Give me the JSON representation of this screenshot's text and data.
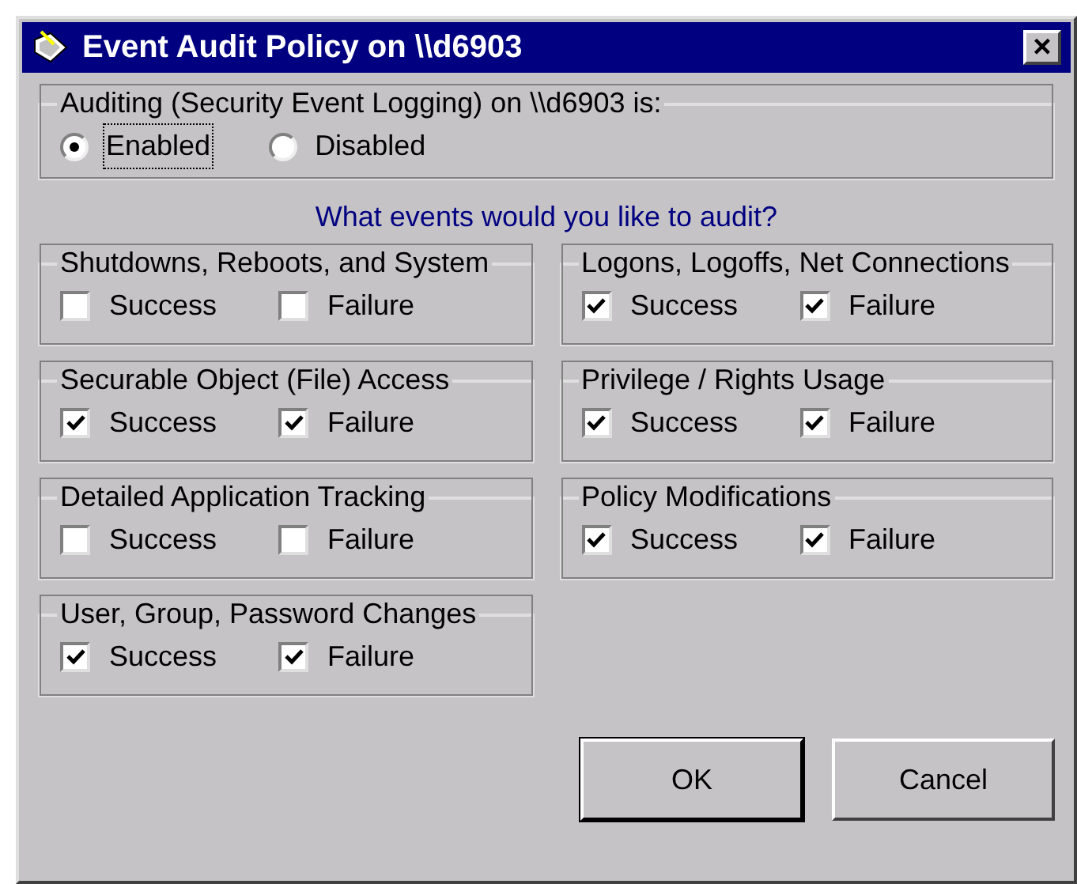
{
  "window": {
    "title": "Event Audit Policy on \\\\d6903",
    "close": "×"
  },
  "auditing": {
    "label": "Auditing (Security Event Logging) on \\\\d6903 is:",
    "options": [
      {
        "label": "Enabled",
        "selected": true
      },
      {
        "label": "Disabled",
        "selected": false
      }
    ]
  },
  "prompt": "What events would you like to audit?",
  "categories": [
    {
      "name": "Shutdowns, Reboots, and System",
      "options": [
        {
          "label": "Success",
          "checked": false
        },
        {
          "label": "Failure",
          "checked": false
        }
      ]
    },
    {
      "name": "Logons, Logoffs, Net Connections",
      "options": [
        {
          "label": "Success",
          "checked": true
        },
        {
          "label": "Failure",
          "checked": true
        }
      ]
    },
    {
      "name": "Securable Object (File) Access",
      "options": [
        {
          "label": "Success",
          "checked": true
        },
        {
          "label": "Failure",
          "checked": true
        }
      ]
    },
    {
      "name": "Privilege / Rights Usage",
      "options": [
        {
          "label": "Success",
          "checked": true
        },
        {
          "label": "Failure",
          "checked": true
        }
      ]
    },
    {
      "name": "Detailed Application Tracking",
      "options": [
        {
          "label": "Success",
          "checked": false
        },
        {
          "label": "Failure",
          "checked": false
        }
      ]
    },
    {
      "name": "Policy Modifications",
      "options": [
        {
          "label": "Success",
          "checked": true
        },
        {
          "label": "Failure",
          "checked": true
        }
      ]
    },
    {
      "name": "User, Group, Password Changes",
      "options": [
        {
          "label": "Success",
          "checked": true
        },
        {
          "label": "Failure",
          "checked": true
        }
      ]
    }
  ],
  "buttons": [
    {
      "label": "OK",
      "default": true
    },
    {
      "label": "Cancel",
      "default": false
    }
  ]
}
